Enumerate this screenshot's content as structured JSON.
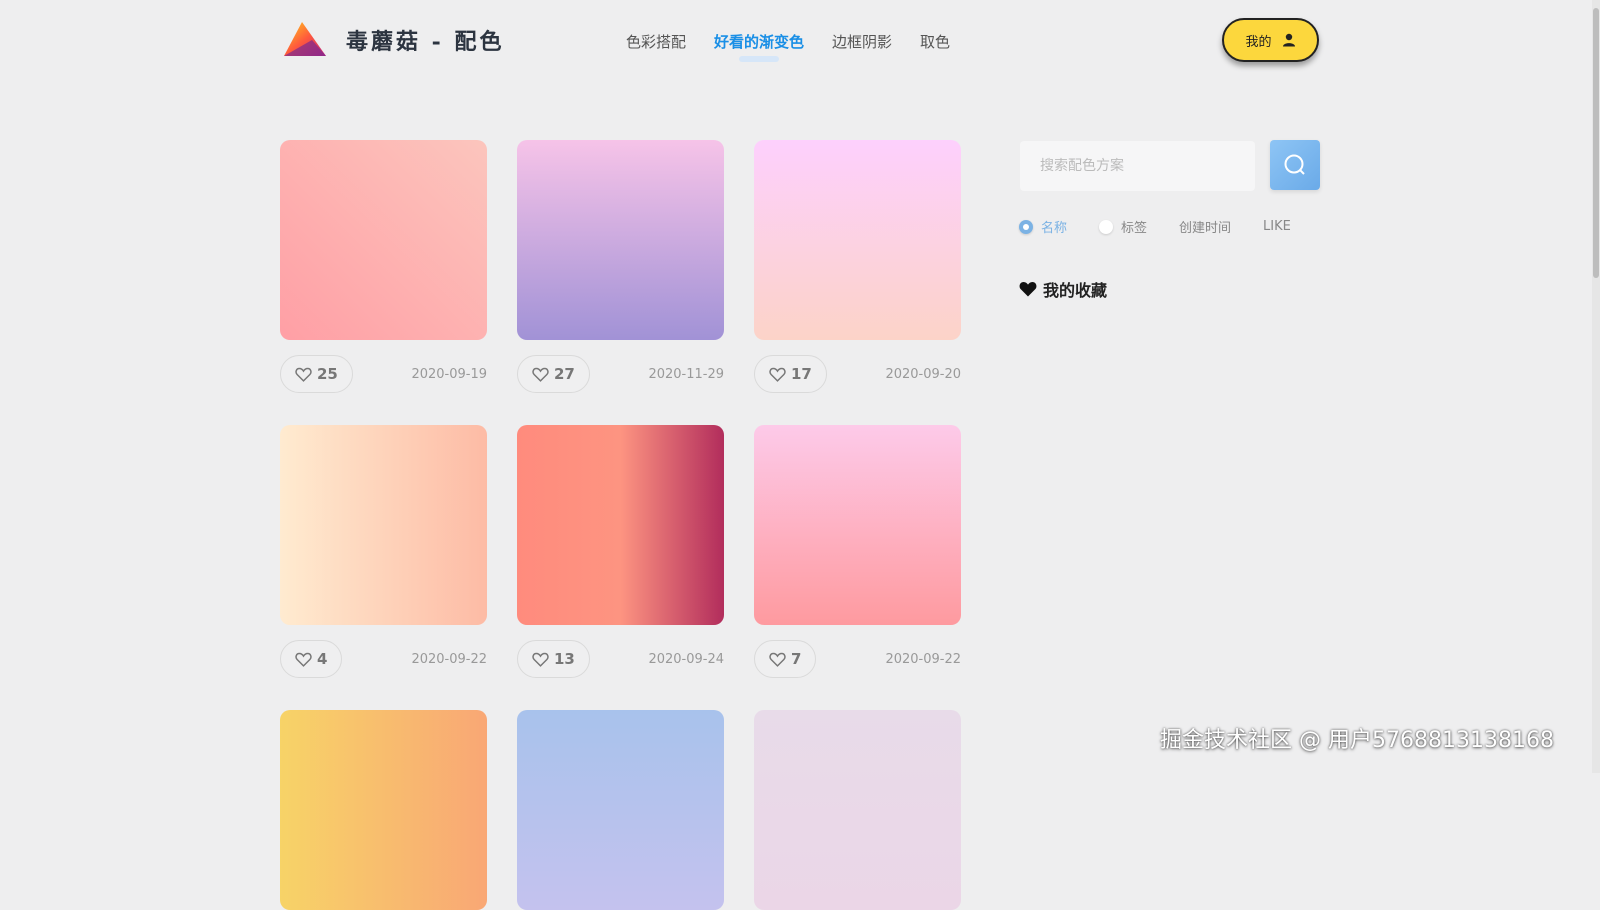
{
  "header": {
    "brand": "毒蘑菇 - 配色",
    "nav": [
      {
        "label": "色彩搭配",
        "active": false
      },
      {
        "label": "好看的渐变色",
        "active": true
      },
      {
        "label": "边框阴影",
        "active": false
      },
      {
        "label": "取色",
        "active": false
      }
    ],
    "me_label": "我的"
  },
  "cards": [
    {
      "likes": "25",
      "date": "2020-09-19",
      "colors": [
        "#fcc5bd",
        "#ff9fa5"
      ],
      "direction": "to bottom left"
    },
    {
      "likes": "27",
      "date": "2020-11-29",
      "colors": [
        "#f6c3e8",
        "#a192d6"
      ],
      "direction": "to bottom"
    },
    {
      "likes": "17",
      "date": "2020-09-20",
      "colors": [
        "#fdd0fd",
        "#fcd3c8"
      ],
      "direction": "to bottom"
    },
    {
      "likes": "4",
      "date": "2020-09-22",
      "colors": [
        "#ffebd0",
        "#fdbba5"
      ],
      "direction": "to right"
    },
    {
      "likes": "13",
      "date": "2020-09-24",
      "colors": [
        "#ff8b7d",
        "#fd9481",
        "#b22d5c"
      ],
      "direction": "to right"
    },
    {
      "likes": "7",
      "date": "2020-09-22",
      "colors": [
        "#fdcae9",
        "#fe9a9f"
      ],
      "direction": "to bottom"
    },
    {
      "likes": "",
      "date": "",
      "colors": [
        "#f7d367",
        "#f9a775"
      ],
      "direction": "to right"
    },
    {
      "likes": "",
      "date": "",
      "colors": [
        "#a8c2ec",
        "#c4c2ee"
      ],
      "direction": "to bottom"
    },
    {
      "likes": "",
      "date": "",
      "colors": [
        "#e8dbe9",
        "#ebd6e7"
      ],
      "direction": "to bottom"
    }
  ],
  "sidebar": {
    "search_placeholder": "搜索配色方案",
    "filters": [
      {
        "label": "名称",
        "radio": true,
        "selected": true
      },
      {
        "label": "标签",
        "radio": true,
        "selected": false
      },
      {
        "label": "创建时间",
        "radio": false,
        "selected": false
      },
      {
        "label": "LIKE",
        "radio": false,
        "selected": false
      }
    ],
    "favorites_label": "我的收藏"
  },
  "watermark": "掘金技术社区 @ 用户5768813138168",
  "colors": {
    "accent": "#1a8fe6",
    "me_button": "#fcd73d",
    "search_button": "#7bb2e4"
  }
}
